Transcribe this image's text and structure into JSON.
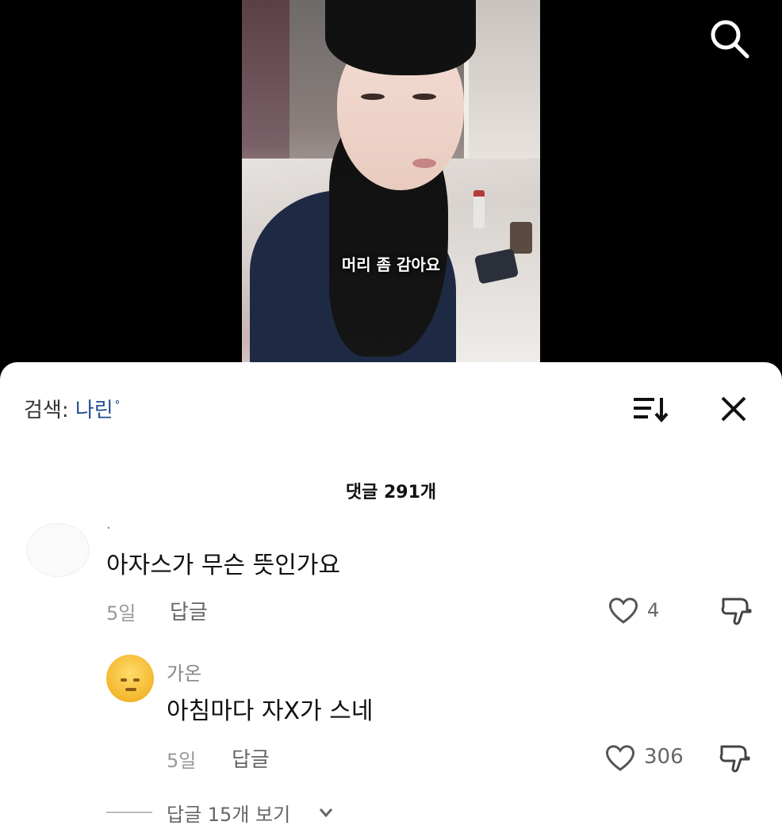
{
  "video": {
    "caption": "머리 좀 감아요"
  },
  "search": {
    "label": "검색:",
    "query": "나린",
    "query_icon": "ᐤ"
  },
  "comments_header": {
    "count_text": "댓글 291개"
  },
  "comments": [
    {
      "username": "·",
      "text": "아자스가 무슨 뜻인가요",
      "time": "5일",
      "reply_label": "답글",
      "likes": "4"
    },
    {
      "username": "가온",
      "text": "아침마다 자X가 스네",
      "time": "5일",
      "reply_label": "답글",
      "likes": "306",
      "view_replies": "답글 15개 보기"
    }
  ],
  "icons": {
    "top_search": "search-icon",
    "sort": "sort-icon",
    "close": "close-icon",
    "like": "heart-icon",
    "dislike": "thumbs-down-icon",
    "expand": "chevron-down-icon"
  },
  "colors": {
    "background": "#000000",
    "sheet": "#ffffff",
    "query_blue": "#1f4f8f",
    "secondary_text": "#666666"
  }
}
